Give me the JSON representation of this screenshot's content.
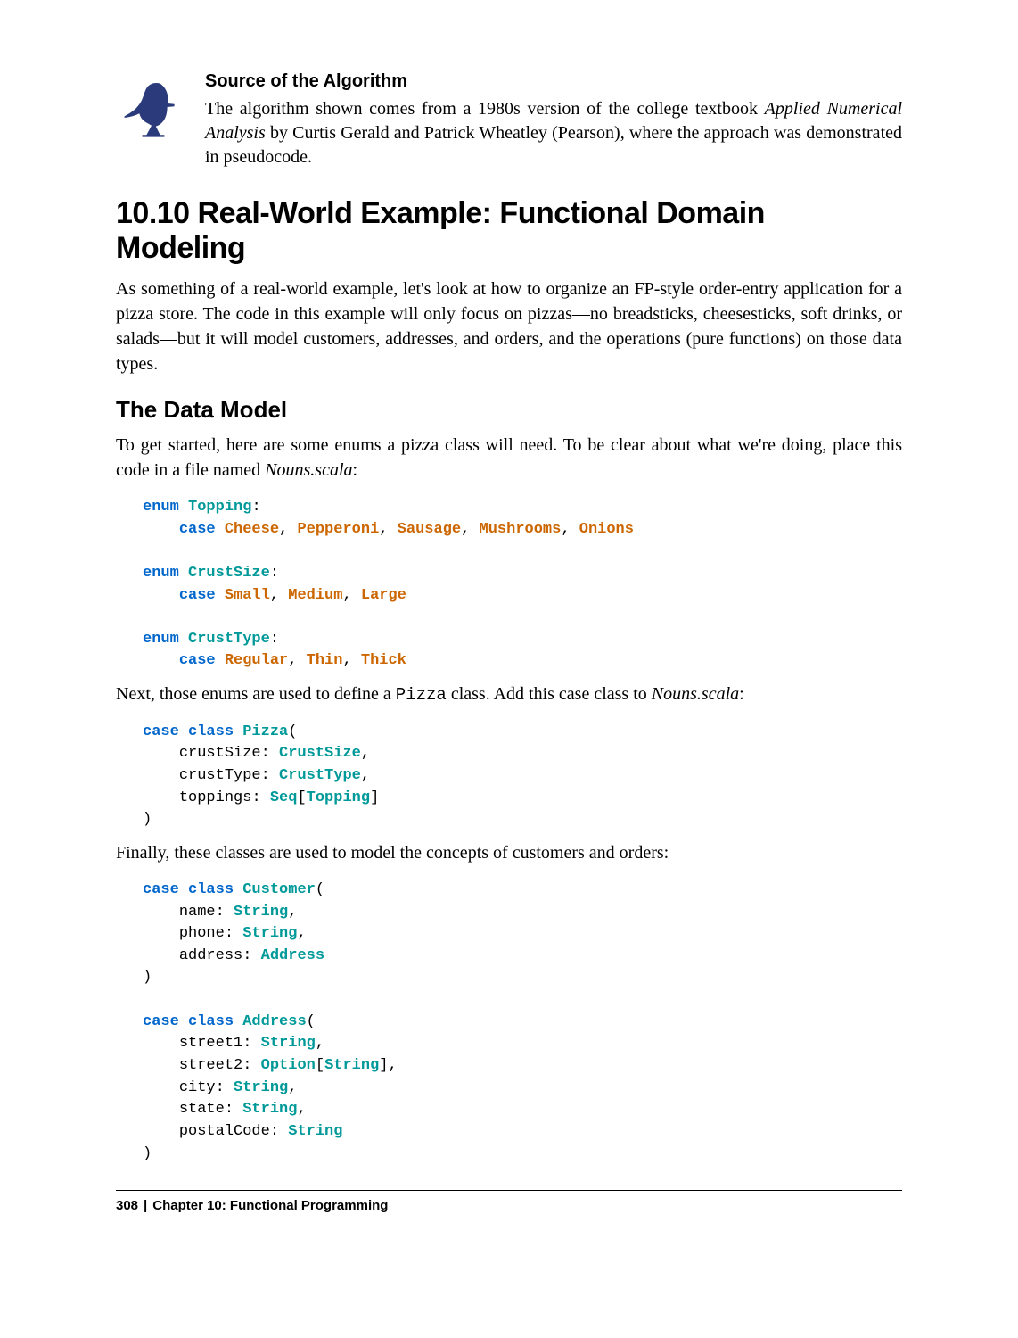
{
  "note": {
    "title": "Source of the Algorithm",
    "text_before_em": "The algorithm shown comes from a 1980s version of the college textbook ",
    "em": "Applied Numerical Analysis",
    "text_after_em": " by Curtis Gerald and Patrick Wheatley (Pearson), where the approach was demonstrated in pseudocode."
  },
  "section": {
    "heading": "10.10 Real-World Example: Functional Domain Modeling",
    "intro": "As something of a real-world example, let's look at how to organize an FP-style order-entry application for a pizza store. The code in this example will only focus on pizzas—no breadsticks, cheesesticks, soft drinks, or salads—but it will model customers, addresses, and orders, and the operations (pure functions) on those data types."
  },
  "subsection": {
    "heading": "The Data Model",
    "para1_before_em": "To get started, here are some enums a pizza class will need. To be clear about what we're doing, place this code in a file named ",
    "para1_em": "Nouns.scala",
    "para1_after_em": ":",
    "para2_a": "Next, those enums are used to define a ",
    "para2_code": "Pizza",
    "para2_b": " class. Add this case class to ",
    "para2_em": "Nouns.scala",
    "para2_c": ":",
    "para3": "Finally, these classes are used to model the concepts of customers and orders:"
  },
  "code1": {
    "enum1": "Topping",
    "cases1": [
      "Cheese",
      "Pepperoni",
      "Sausage",
      "Mushrooms",
      "Onions"
    ],
    "enum2": "CrustSize",
    "cases2": [
      "Small",
      "Medium",
      "Large"
    ],
    "enum3": "CrustType",
    "cases3": [
      "Regular",
      "Thin",
      "Thick"
    ]
  },
  "code2": {
    "class": "Pizza",
    "fields": [
      {
        "name": "crustSize",
        "type": "CrustSize"
      },
      {
        "name": "crustType",
        "type": "CrustType"
      },
      {
        "name": "toppings",
        "type_outer": "Seq",
        "type_inner": "Topping"
      }
    ]
  },
  "code3": {
    "class1": "Customer",
    "fields1": [
      {
        "name": "name",
        "type": "String"
      },
      {
        "name": "phone",
        "type": "String"
      },
      {
        "name": "address",
        "type": "Address"
      }
    ],
    "class2": "Address",
    "fields2": [
      {
        "name": "street1",
        "type": "String"
      },
      {
        "name": "street2",
        "type_outer": "Option",
        "type_inner": "String"
      },
      {
        "name": "city",
        "type": "String"
      },
      {
        "name": "state",
        "type": "String"
      },
      {
        "name": "postalCode",
        "type": "String"
      }
    ]
  },
  "keywords": {
    "enum": "enum",
    "case": "case",
    "case_class": "case class"
  },
  "footer": {
    "page": "308",
    "chapter": "Chapter 10: Functional Programming"
  }
}
